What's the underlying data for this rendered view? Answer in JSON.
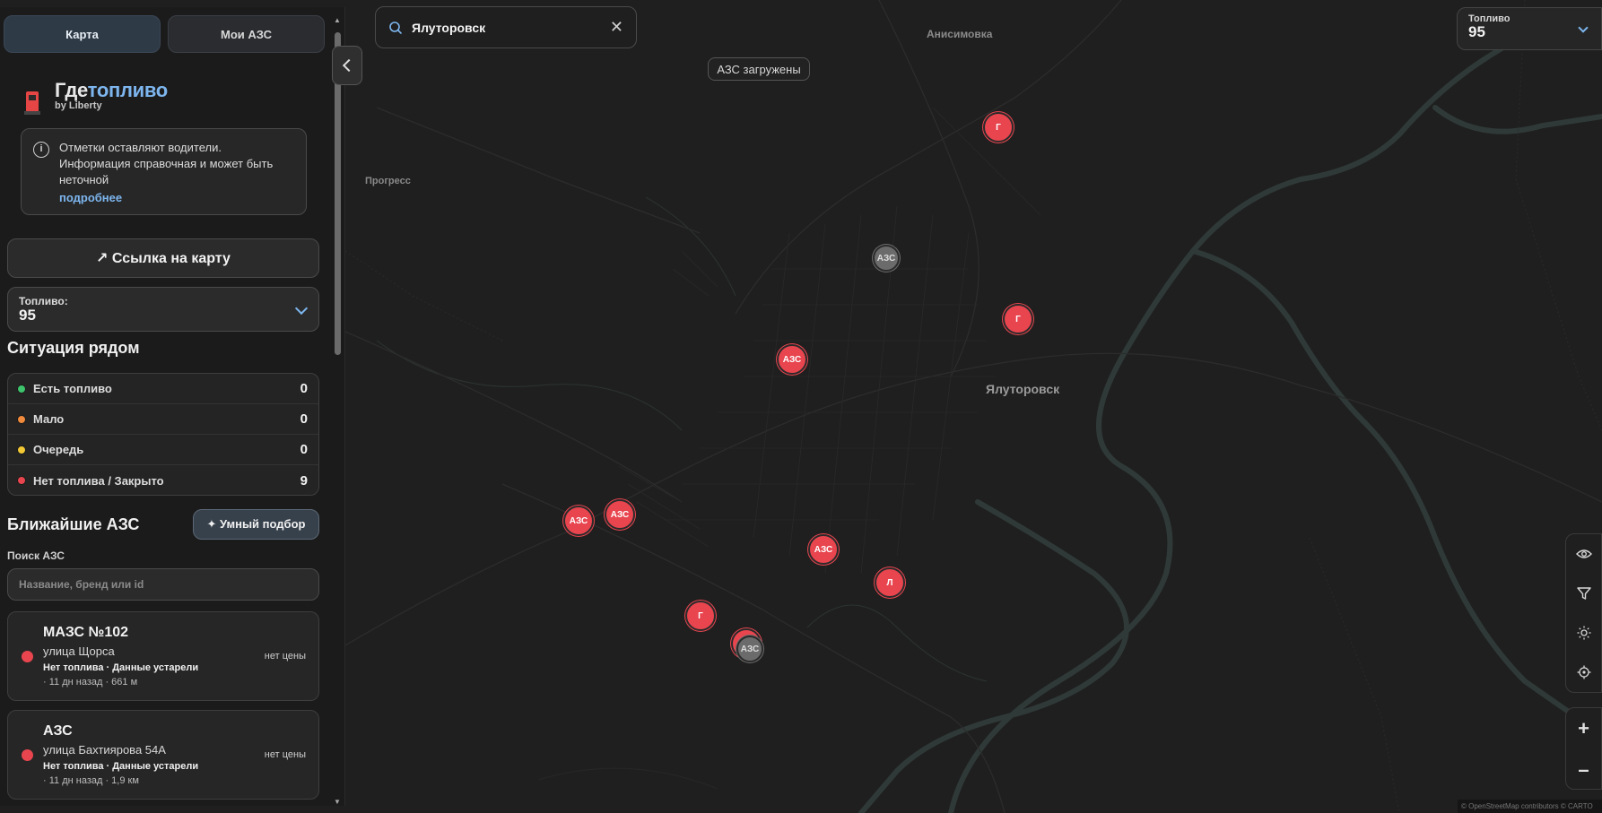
{
  "tabs": [
    {
      "label": "Карта"
    },
    {
      "label": "Мои АЗС"
    }
  ],
  "brand": {
    "title_prefix": "Где",
    "title_accent": "топливо",
    "subtitle": "by Liberty"
  },
  "info": {
    "text": "Отметки оставляют водители. Информация справочная и может быть неточной",
    "link": "подробнее"
  },
  "share_button": "↗ Ссылка на карту",
  "fuel": {
    "label": "Топливо:",
    "value": "95"
  },
  "situation": {
    "title": "Ситуация рядом",
    "rows": [
      {
        "label": "Есть топливо",
        "count": "0",
        "color": "#3ec46d"
      },
      {
        "label": "Мало",
        "count": "0",
        "color": "#f08a3c"
      },
      {
        "label": "Очередь",
        "count": "0",
        "color": "#f2c935"
      },
      {
        "label": "Нет топлива / Закрыто",
        "count": "9",
        "color": "#e8454f"
      }
    ]
  },
  "nearest": {
    "title": "Ближайшие АЗС",
    "smart_button": "✦ Умный подбор",
    "search_label": "Поиск АЗС",
    "search_placeholder": "Название, бренд или id",
    "stations": [
      {
        "name": "МАЗС №102",
        "address": "улица Щорса",
        "status": "Нет топлива · Данные устарели",
        "meta": "· 11 дн назад  · 661 м",
        "price": "нет цены"
      },
      {
        "name": "АЗС",
        "address": "улица Бахтиярова 54А",
        "status": "Нет топлива · Данные устарели",
        "meta": "· 11 дн назад  · 1,9 км",
        "price": "нет цены"
      }
    ]
  },
  "map": {
    "search_query": "Ялуторовск",
    "toast": "АЗС загружены",
    "top_fuel": {
      "label": "Топливо",
      "value": "95"
    },
    "labels": {
      "anisimovka": "Анисимовка",
      "progress": "Прогресс",
      "city": "Ялуторовск"
    },
    "markers": {
      "m1": "Г",
      "m2": "АЗС",
      "m3": "Г",
      "m4": "АЗС",
      "m5": "АЗС",
      "m6": "АЗС",
      "m7": "АЗС",
      "m8": "Л",
      "m9": "Г",
      "m10": "АЗС",
      "m11": "АЗС"
    },
    "attribution": "© OpenStreetMap contributors © CARTO",
    "tool_icons": [
      "eye-icon",
      "filter-icon",
      "sun-icon",
      "locate-icon"
    ],
    "zoom_in": "+",
    "zoom_out": "–"
  }
}
